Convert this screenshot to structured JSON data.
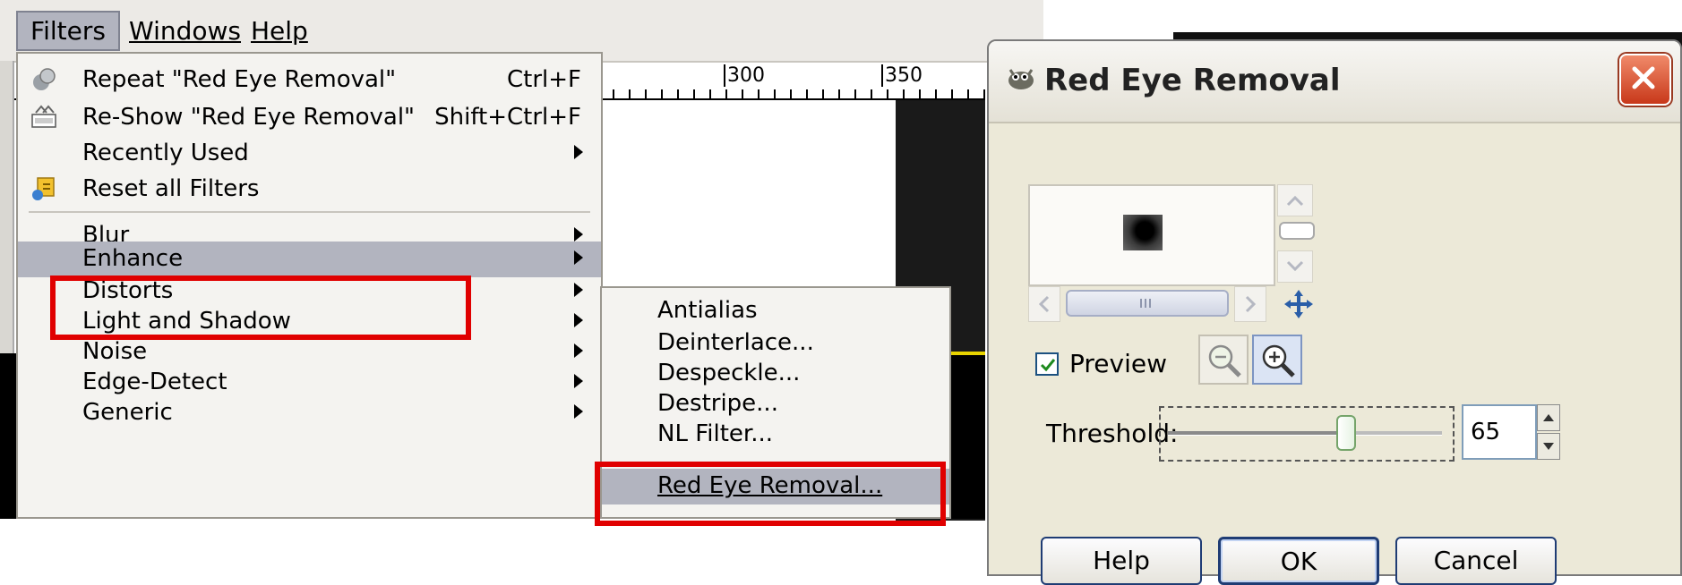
{
  "menubar": {
    "items": [
      {
        "label": "Filters",
        "mnemonic_index": 4
      },
      {
        "label": "Windows",
        "mnemonic_index": 0
      },
      {
        "label": "Help",
        "mnemonic_index": 0
      }
    ]
  },
  "ruler": {
    "labels": [
      "300",
      "350"
    ]
  },
  "filters_menu": {
    "items": [
      {
        "label": "Repeat \"Red Eye Removal\"",
        "accel": "Ctrl+F",
        "icon": "repeat-icon"
      },
      {
        "label": "Re-Show \"Red Eye Removal\"",
        "accel": "Shift+Ctrl+F",
        "icon": "reshow-icon"
      },
      {
        "label": "Recently Used",
        "submenu": true
      },
      {
        "label": "Reset all Filters",
        "icon": "reset-icon"
      },
      {
        "label": "Blur",
        "submenu": true
      },
      {
        "label": "Enhance",
        "submenu": true,
        "highlighted": true
      },
      {
        "label": "Distorts",
        "submenu": true
      },
      {
        "label": "Light and Shadow",
        "submenu": true
      },
      {
        "label": "Noise",
        "submenu": true
      },
      {
        "label": "Edge-Detect",
        "submenu": true
      },
      {
        "label": "Generic",
        "submenu": true
      }
    ]
  },
  "enhance_submenu": {
    "items": [
      {
        "label": "Antialias"
      },
      {
        "label": "Deinterlace..."
      },
      {
        "label": "Despeckle..."
      },
      {
        "label": "Destripe..."
      },
      {
        "label": "NL Filter..."
      },
      {
        "label": "Red Eye Removal...",
        "highlighted": true
      }
    ]
  },
  "dialog": {
    "title": "Red Eye Removal",
    "preview_label": "Preview",
    "preview_checked": true,
    "threshold_label": "Threshold:",
    "threshold_value": "65",
    "threshold_fraction": 0.65,
    "buttons": {
      "help": "Help",
      "ok": "OK",
      "cancel": "Cancel"
    }
  },
  "colors": {
    "highlight": "#b2b4bf",
    "annotation_red": "#e00000",
    "menu_bg": "#f4f3f0",
    "dialog_bg": "#ece9d8"
  }
}
